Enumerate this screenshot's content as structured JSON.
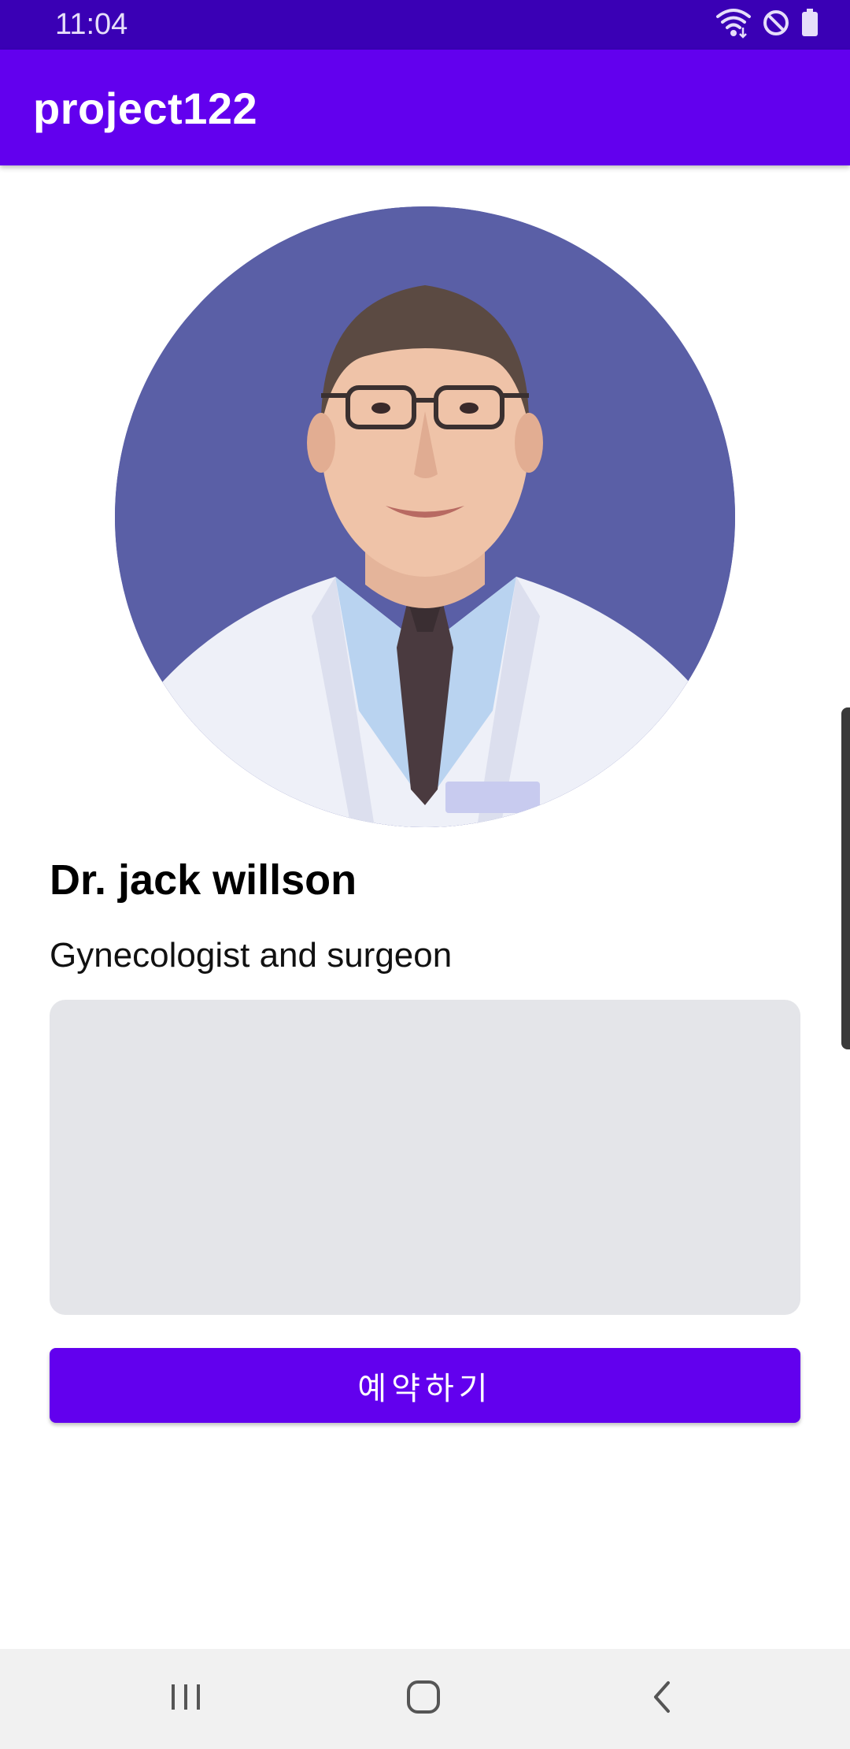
{
  "status_bar": {
    "time": "11:04",
    "icons": [
      "wifi-icon",
      "do-not-disturb-icon",
      "battery-icon"
    ]
  },
  "app_bar": {
    "title": "project122"
  },
  "profile": {
    "photo": "doctor-photo",
    "name": "Dr. jack willson",
    "specialty": "Gynecologist and surgeon",
    "description": ""
  },
  "actions": {
    "book_label": "예약하기"
  },
  "nav_bar": {
    "icons": [
      "recent-apps-icon",
      "home-icon",
      "back-icon"
    ]
  },
  "colors": {
    "primary": "#6200ee",
    "status_bar": "#3a00b5",
    "description_box": "#e4e5e9",
    "nav_bar": "#f1f1f1"
  }
}
